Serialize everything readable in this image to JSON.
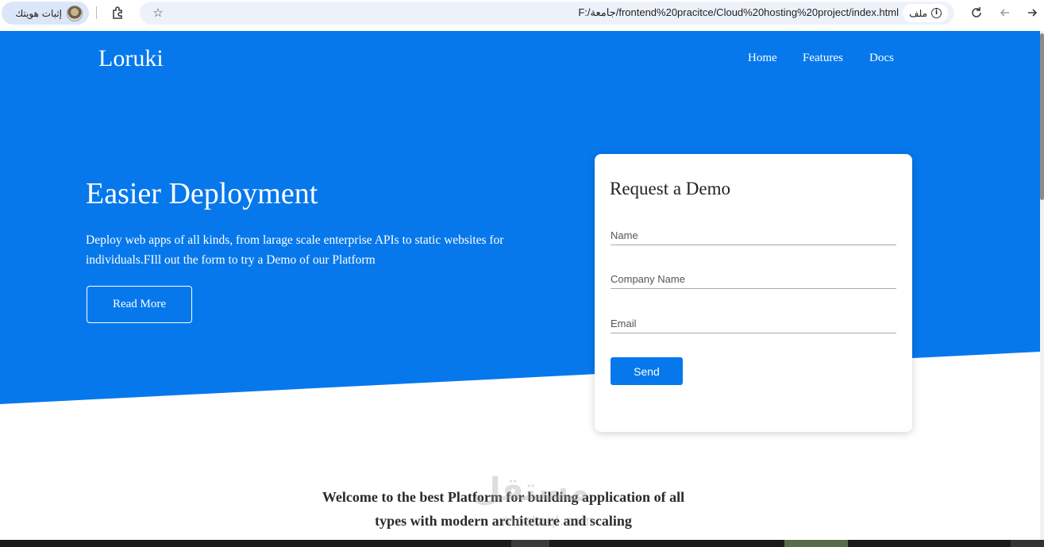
{
  "browser": {
    "profile_label": "إثبات هويتك",
    "url": "F:/جامعة/frontend%20pracitce/Cloud%20hosting%20project/index.html",
    "site_chip_label": "ملف",
    "icons": [
      "profile-avatar-icon",
      "extensions-icon",
      "bookmark-star-icon",
      "info-icon",
      "reload-icon",
      "back-icon",
      "forward-icon"
    ]
  },
  "site": {
    "brand": "Loruki",
    "nav": [
      {
        "label": "Home"
      },
      {
        "label": "Features"
      },
      {
        "label": "Docs"
      }
    ],
    "hero": {
      "title": "Easier Deployment",
      "text": "Deploy web apps of all kinds, from larage scale enterprise APIs to static websites for individuals.FIll out the form to try a Demo of our Platform",
      "button": "Read More"
    },
    "demo_form": {
      "title": "Request a Demo",
      "fields": [
        {
          "placeholder": "Name",
          "value": ""
        },
        {
          "placeholder": "Company Name",
          "value": ""
        },
        {
          "placeholder": "Email",
          "value": ""
        }
      ],
      "submit": "Send"
    },
    "welcome": "Welcome to the best Platform for building application of all types with modern architeture and scaling"
  },
  "watermark": {
    "text": "مستقل",
    "sub": "mostaql.com"
  },
  "colors": {
    "accent": "#0678ec",
    "background": "#ffffff",
    "text_dark": "#2a2a2a"
  }
}
